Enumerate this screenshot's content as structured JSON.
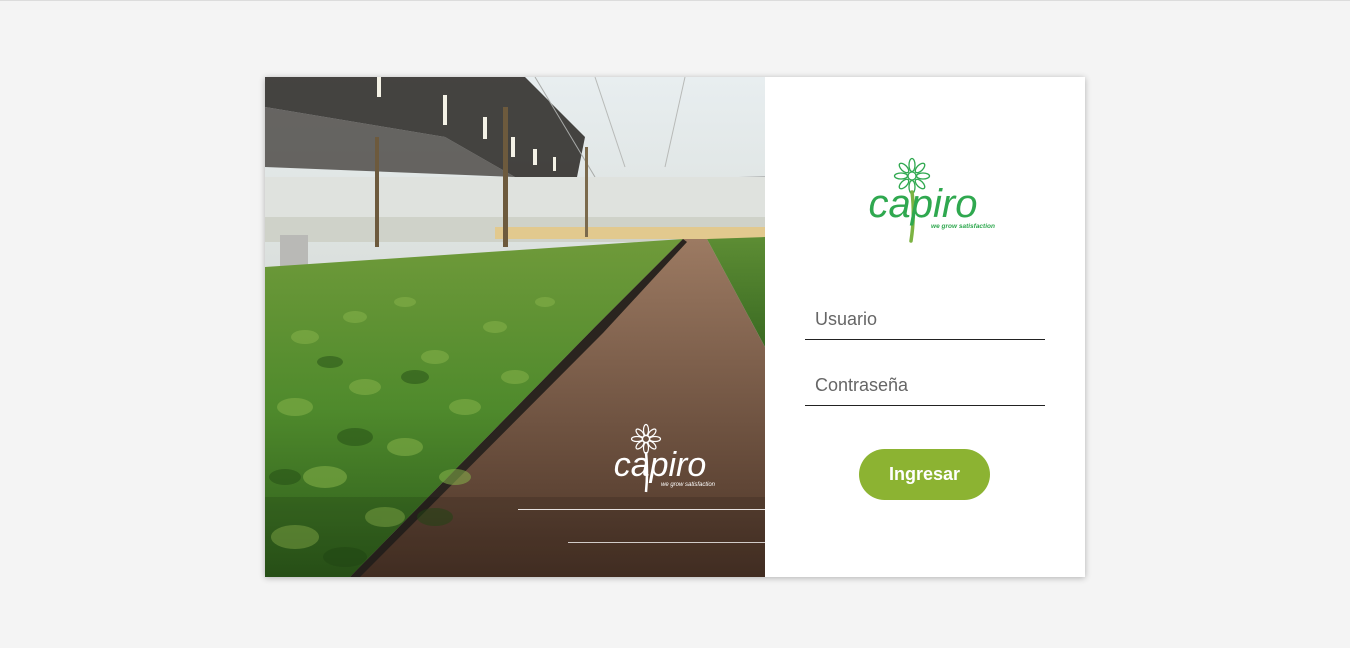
{
  "brand": {
    "logo_text": "capiro",
    "tagline": "we grow satisfaction",
    "colors": {
      "green": "#2fa84f",
      "button_green": "#8cb332"
    }
  },
  "photo": {
    "logo_text": "capiro",
    "tagline": "we grow satisfaction"
  },
  "form": {
    "username_placeholder": "Usuario",
    "password_placeholder": "Contraseña",
    "submit_label": "Ingresar"
  },
  "icons": {
    "brand_flower": "daisy-flower-icon",
    "photo_flower": "daisy-flower-icon"
  }
}
